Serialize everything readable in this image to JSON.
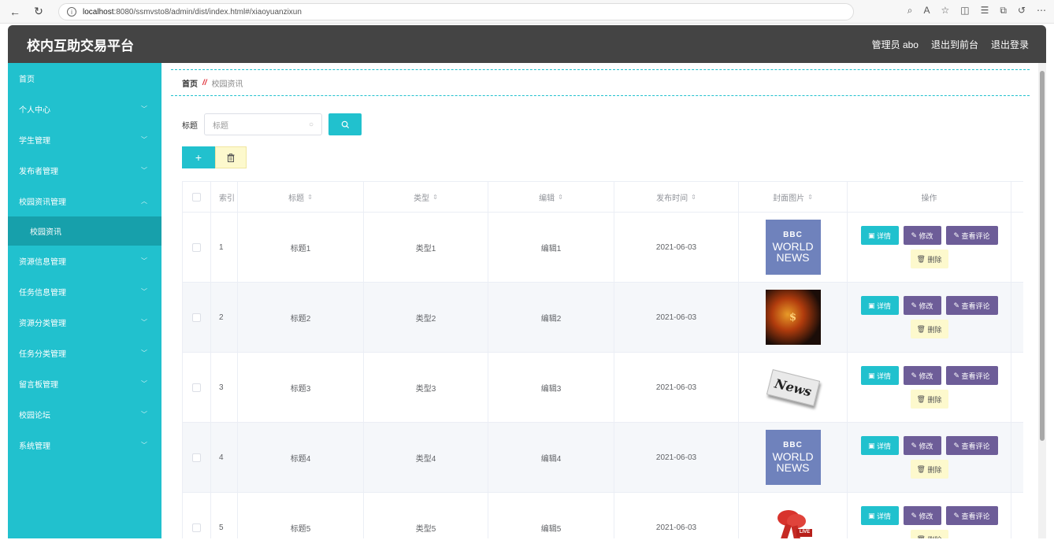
{
  "browser": {
    "url_host": "localhost",
    "url_rest": ":8080/ssmvsto8/admin/dist/index.html#/xiaoyuanzixun"
  },
  "header": {
    "title": "校内互助交易平台",
    "admin_label": "管理员 abo",
    "to_front": "退出到前台",
    "logout": "退出登录"
  },
  "sidebar": {
    "items": [
      {
        "label": "首页",
        "chevron": ""
      },
      {
        "label": "个人中心",
        "chevron": "﹀"
      },
      {
        "label": "学生管理",
        "chevron": "﹀"
      },
      {
        "label": "发布者管理",
        "chevron": "﹀"
      },
      {
        "label": "校园资讯管理",
        "chevron": "︿"
      },
      {
        "label": "校园资讯",
        "chevron": ""
      },
      {
        "label": "资源信息管理",
        "chevron": "﹀"
      },
      {
        "label": "任务信息管理",
        "chevron": "﹀"
      },
      {
        "label": "资源分类管理",
        "chevron": "﹀"
      },
      {
        "label": "任务分类管理",
        "chevron": "﹀"
      },
      {
        "label": "留言板管理",
        "chevron": "﹀"
      },
      {
        "label": "校园论坛",
        "chevron": "﹀"
      },
      {
        "label": "系统管理",
        "chevron": "﹀"
      }
    ]
  },
  "breadcrumb": {
    "home": "首页",
    "sep": "//",
    "current": "校园资讯"
  },
  "search": {
    "label": "标题",
    "placeholder": "标题",
    "button_icon": "search-icon"
  },
  "toolbar": {
    "add_icon": "+",
    "delete_icon": "trash-icon"
  },
  "table": {
    "headers": {
      "index": "索引",
      "title": "标题",
      "type": "类型",
      "editor": "编辑",
      "date": "发布时间",
      "image": "封面图片",
      "ops": "操作"
    },
    "sort_glyph": "⇕",
    "rows": [
      {
        "index": "1",
        "title": "标题1",
        "type": "类型1",
        "editor": "编辑1",
        "date": "2021-06-03",
        "image": "bbc-world-news"
      },
      {
        "index": "2",
        "title": "标题2",
        "type": "类型2",
        "editor": "编辑2",
        "date": "2021-06-03",
        "image": "dark-fire"
      },
      {
        "index": "3",
        "title": "标题3",
        "type": "类型3",
        "editor": "编辑3",
        "date": "2021-06-03",
        "image": "news-paper"
      },
      {
        "index": "4",
        "title": "标题4",
        "type": "类型4",
        "editor": "编辑4",
        "date": "2021-06-03",
        "image": "bbc-world-news"
      },
      {
        "index": "5",
        "title": "标题5",
        "type": "类型5",
        "editor": "编辑5",
        "date": "2021-06-03",
        "image": "live-mic"
      }
    ],
    "ops": {
      "detail": "详情",
      "edit": "修改",
      "comment": "查看评论",
      "delete": "删除"
    }
  },
  "thumbnails": {
    "bbc_line1": "BBC",
    "bbc_line2": "WORLD",
    "bbc_line3": "NEWS",
    "news_word": "News",
    "live_word": "LIVE",
    "fire_word": "$"
  },
  "colors": {
    "accent": "#21c1ce",
    "topbar": "#444444",
    "purple": "#6d5d98",
    "yellow": "#fdf9cd"
  }
}
